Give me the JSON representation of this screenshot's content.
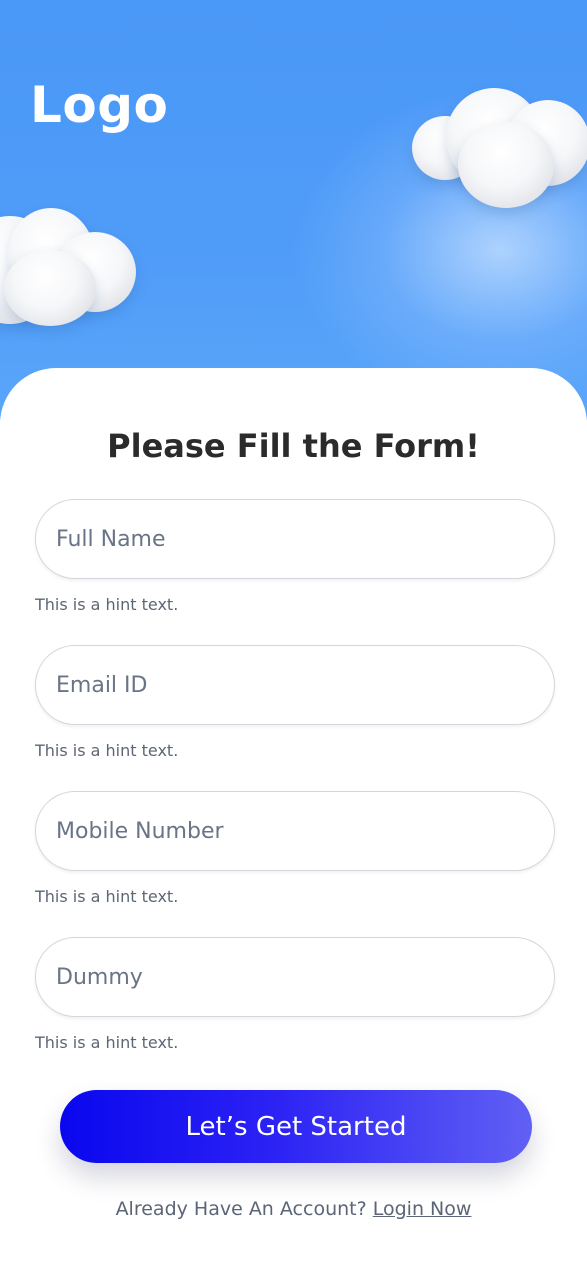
{
  "header": {
    "logo_text": "Logo"
  },
  "form": {
    "title": "Please Fill the Form!",
    "fields": [
      {
        "placeholder": "Full Name",
        "hint": "This is a hint text."
      },
      {
        "placeholder": "Email ID",
        "hint": "This is a hint text."
      },
      {
        "placeholder": "Mobile Number",
        "hint": "This is a hint text."
      },
      {
        "placeholder": "Dummy",
        "hint": "This is a hint text."
      }
    ],
    "submit_label": "Let’s Get Started"
  },
  "footer": {
    "prompt": "Already Have An Account?",
    "login_link": "Login Now"
  },
  "colors": {
    "sky": "#4f9cf8",
    "button_gradient_start": "#0a07ef",
    "button_gradient_end": "#6160f4",
    "title_text": "#2b2b2b",
    "hint_text": "#5d6673"
  },
  "icons": [
    "cloud-icon",
    "cloud-icon"
  ]
}
